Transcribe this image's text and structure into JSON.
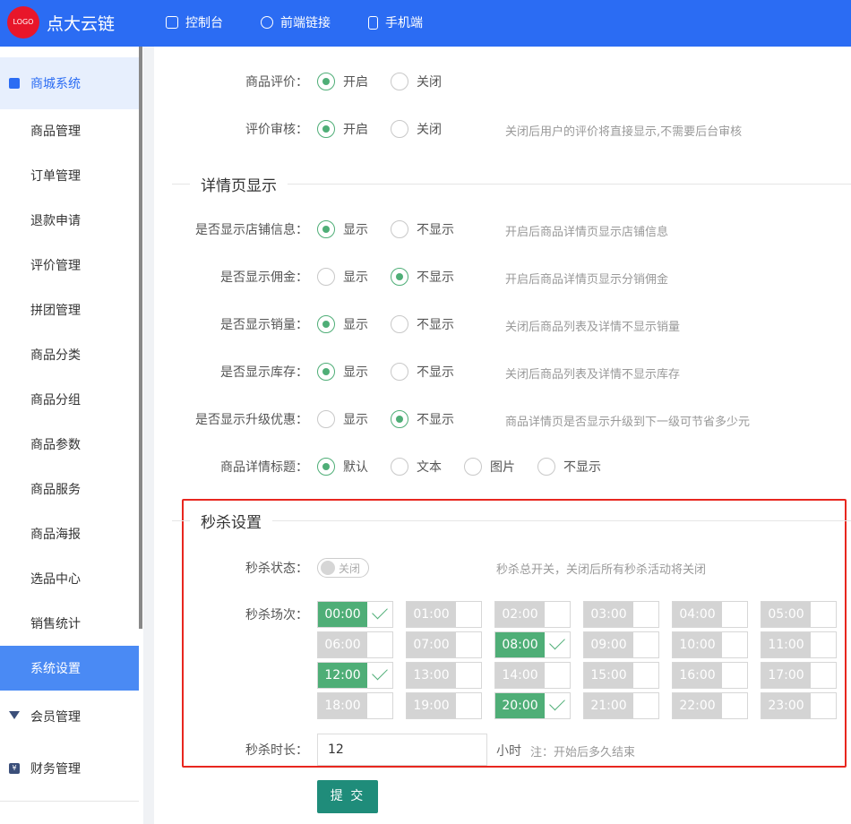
{
  "header": {
    "logo_text": "LOGO",
    "brand": "点大云链",
    "nav": [
      {
        "label": "控制台",
        "icon": "dashboard-icon"
      },
      {
        "label": "前端链接",
        "icon": "link-icon"
      },
      {
        "label": "手机端",
        "icon": "mobile-icon"
      }
    ]
  },
  "sidebar": {
    "group": "商城系统",
    "items": [
      "商品管理",
      "订单管理",
      "退款申请",
      "评价管理",
      "拼团管理",
      "商品分类",
      "商品分组",
      "商品参数",
      "商品服务",
      "商品海报",
      "选品中心",
      "销售统计",
      "系统设置"
    ],
    "groups_below": [
      "会员管理",
      "财务管理"
    ]
  },
  "review": {
    "rows": [
      {
        "label": "商品评价：",
        "opt1": "开启",
        "opt2": "关闭",
        "checked": 0,
        "hint": ""
      },
      {
        "label": "评价审核：",
        "opt1": "开启",
        "opt2": "关闭",
        "checked": 0,
        "hint": "关闭后用户的评价将直接显示,不需要后台审核"
      }
    ]
  },
  "detail": {
    "title": "详情页显示",
    "rows": [
      {
        "label": "是否显示店铺信息：",
        "opt1": "显示",
        "opt2": "不显示",
        "checked": 0,
        "hint": "开启后商品详情页显示店铺信息"
      },
      {
        "label": "是否显示佣金：",
        "opt1": "显示",
        "opt2": "不显示",
        "checked": 1,
        "hint": "开启后商品详情页显示分销佣金"
      },
      {
        "label": "是否显示销量：",
        "opt1": "显示",
        "opt2": "不显示",
        "checked": 0,
        "hint": "关闭后商品列表及详情不显示销量"
      },
      {
        "label": "是否显示库存：",
        "opt1": "显示",
        "opt2": "不显示",
        "checked": 0,
        "hint": "关闭后商品列表及详情不显示库存"
      },
      {
        "label": "是否显示升级优惠：",
        "opt1": "显示",
        "opt2": "不显示",
        "checked": 1,
        "hint": "商品详情页是否显示升级到下一级可节省多少元"
      }
    ],
    "title_row": {
      "label": "商品详情标题：",
      "options": [
        "默认",
        "文本",
        "图片",
        "不显示"
      ],
      "checked": 0
    }
  },
  "seckill": {
    "title": "秒杀设置",
    "status_label": "秒杀状态：",
    "status_text": "关闭",
    "status_hint": "秒杀总开关，关闭后所有秒杀活动将关闭",
    "slots_label": "秒杀场次：",
    "slots": [
      "00:00",
      "01:00",
      "02:00",
      "03:00",
      "04:00",
      "05:00",
      "06:00",
      "07:00",
      "08:00",
      "09:00",
      "10:00",
      "11:00",
      "12:00",
      "13:00",
      "14:00",
      "15:00",
      "16:00",
      "17:00",
      "18:00",
      "19:00",
      "20:00",
      "21:00",
      "22:00",
      "23:00"
    ],
    "selected": [
      "00:00",
      "08:00",
      "12:00",
      "20:00"
    ],
    "duration_label": "秒杀时长：",
    "duration_value": "12",
    "duration_unit": "小时",
    "duration_note": "注：开始后多久结束"
  },
  "submit_label": "提 交"
}
